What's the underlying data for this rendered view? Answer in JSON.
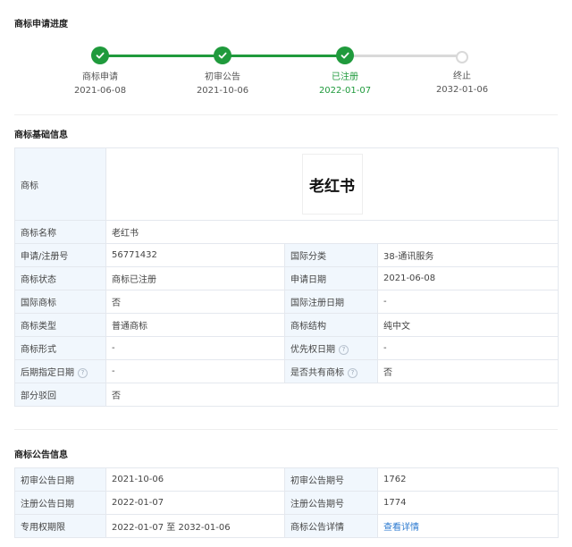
{
  "progress": {
    "title": "商标申请进度",
    "steps": [
      {
        "name": "商标申请",
        "date": "2021-06-08",
        "status": "done"
      },
      {
        "name": "初审公告",
        "date": "2021-10-06",
        "status": "done"
      },
      {
        "name": "已注册",
        "date": "2022-01-07",
        "status": "current"
      },
      {
        "name": "终止",
        "date": "2032-01-06",
        "status": "pending"
      }
    ],
    "colors": {
      "active": "#1f9a3c",
      "inactive": "#d9d9d9"
    }
  },
  "basic": {
    "title": "商标基础信息",
    "trademark_label": "商标",
    "trademark_text": "老红书",
    "name_label": "商标名称",
    "name_value": "老红书",
    "rows": [
      {
        "l1": "申请/注册号",
        "v1": "56771432",
        "l2": "国际分类",
        "v2": "38-通讯服务"
      },
      {
        "l1": "商标状态",
        "v1": "商标已注册",
        "l2": "申请日期",
        "v2": "2021-06-08"
      },
      {
        "l1": "国际商标",
        "v1": "否",
        "l2": "国际注册日期",
        "v2": "-"
      },
      {
        "l1": "商标类型",
        "v1": "普通商标",
        "l2": "商标结构",
        "v2": "纯中文"
      },
      {
        "l1": "商标形式",
        "v1": "-",
        "l2": "优先权日期",
        "v2": "-"
      },
      {
        "l1": "后期指定日期",
        "v1": "-",
        "l2": "是否共有商标",
        "v2": "否"
      }
    ],
    "partial_label": "部分驳回",
    "partial_value": "否",
    "help_glyph": "?"
  },
  "announce": {
    "title": "商标公告信息",
    "rows": [
      {
        "l1": "初审公告日期",
        "v1": "2021-10-06",
        "l2": "初审公告期号",
        "v2": "1762"
      },
      {
        "l1": "注册公告日期",
        "v1": "2022-01-07",
        "l2": "注册公告期号",
        "v2": "1774"
      },
      {
        "l1": "专用权期限",
        "v1": "2022-01-07 至 2032-01-06",
        "l2": "商标公告详情",
        "v2": "查看详情"
      }
    ]
  }
}
